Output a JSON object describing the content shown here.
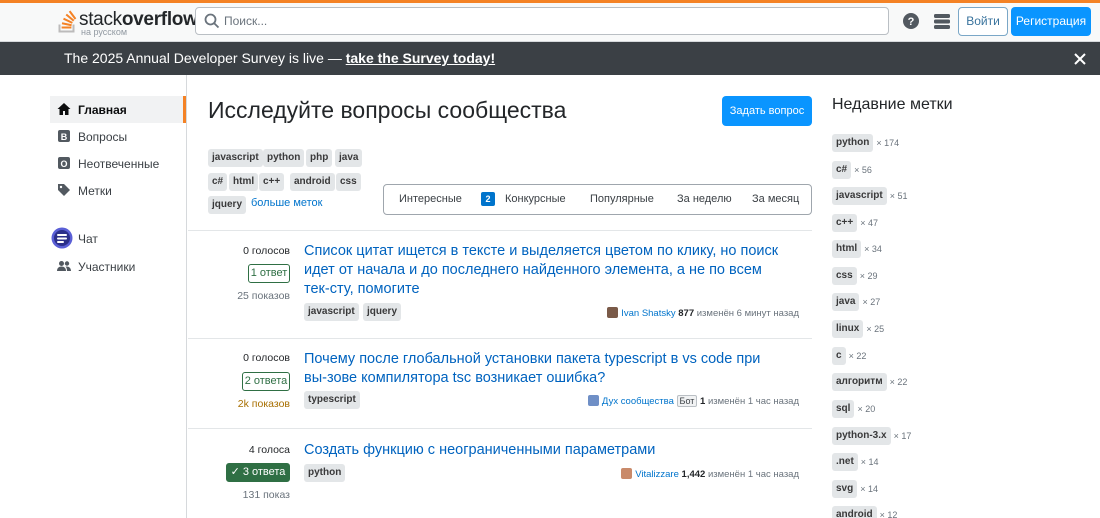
{
  "header": {
    "logo_text_regular": "stack",
    "logo_text_bold": "overflow",
    "logo_sub": "на русском",
    "search_placeholder": "Поиск...",
    "login_label": "Войти",
    "register_label": "Регистрация"
  },
  "banner": {
    "text": "The 2025 Annual Developer Survey is live — ",
    "link": "take the Survey today!"
  },
  "sidebar": {
    "items": [
      {
        "label": "Главная",
        "icon": "home-icon"
      },
      {
        "label": "Вопросы",
        "icon": "questions-icon"
      },
      {
        "label": "Неотвеченные",
        "icon": "unanswered-icon"
      },
      {
        "label": "Метки",
        "icon": "tag-icon"
      },
      {
        "label": "Чат",
        "icon": "chat-icon"
      },
      {
        "label": "Участники",
        "icon": "users-icon"
      }
    ]
  },
  "main": {
    "title": "Исследуйте вопросы сообщества",
    "ask_label": "Задать вопрос",
    "filter_tags": [
      "javascript",
      "python",
      "php",
      "java",
      "c#",
      "html",
      "c++",
      "android",
      "css",
      "jquery"
    ],
    "more_tags": "больше меток",
    "tabs": [
      "Интересные",
      "2",
      "Конкурсные",
      "Популярные",
      "За неделю",
      "За месяц"
    ]
  },
  "questions": [
    {
      "votes": "0 голосов",
      "answers": "1 ответ",
      "views": "25 показов",
      "title": "Список цитат ищется в тексте и выделяется цветом по клику, но поиск идет от начала и до последнего найденного элемента, а не по всем тек-сту, помогите",
      "tags": [
        "javascript",
        "jquery"
      ],
      "user": "Ivan Shatsky",
      "rep": "877",
      "time": "изменён 6 минут назад"
    },
    {
      "votes": "0 голосов",
      "answers": "2 ответа",
      "views": "2k показов",
      "title": "Почему после глобальной установки пакета typescript в vs code при вы-зове компилятора tsc возникает ошибка?",
      "tags": [
        "typescript"
      ],
      "user": "Дух сообщества",
      "bot": "Бот",
      "rep": "1",
      "time": "изменён 1 час назад"
    },
    {
      "votes": "4 голоса",
      "answers": "✓ 3 ответа",
      "views": "131 показ",
      "title": "Создать функцию с неограниченными параметрами",
      "tags": [
        "python"
      ],
      "user": "Vitalizzare",
      "rep": "1,442",
      "time": "изменён 1 час назад"
    }
  ],
  "right": {
    "title": "Недавние метки",
    "tags": [
      {
        "name": "python",
        "count": "× 174"
      },
      {
        "name": "c#",
        "count": "× 56"
      },
      {
        "name": "javascript",
        "count": "× 51"
      },
      {
        "name": "c++",
        "count": "× 47"
      },
      {
        "name": "html",
        "count": "× 34"
      },
      {
        "name": "css",
        "count": "× 29"
      },
      {
        "name": "java",
        "count": "× 27"
      },
      {
        "name": "linux",
        "count": "× 25"
      },
      {
        "name": "c",
        "count": "× 22"
      },
      {
        "name": "алгоритм",
        "count": "× 22"
      },
      {
        "name": "sql",
        "count": "× 20"
      },
      {
        "name": "python-3.x",
        "count": "× 17"
      },
      {
        "name": ".net",
        "count": "× 14"
      },
      {
        "name": "svg",
        "count": "× 14"
      },
      {
        "name": "android",
        "count": "× 12"
      }
    ]
  },
  "colors": {
    "accent": "#f48225",
    "link": "#0074cc",
    "primary_button": "#0a95ff",
    "banner_bg": "#3b4045",
    "accepted": "#2f6f44"
  }
}
